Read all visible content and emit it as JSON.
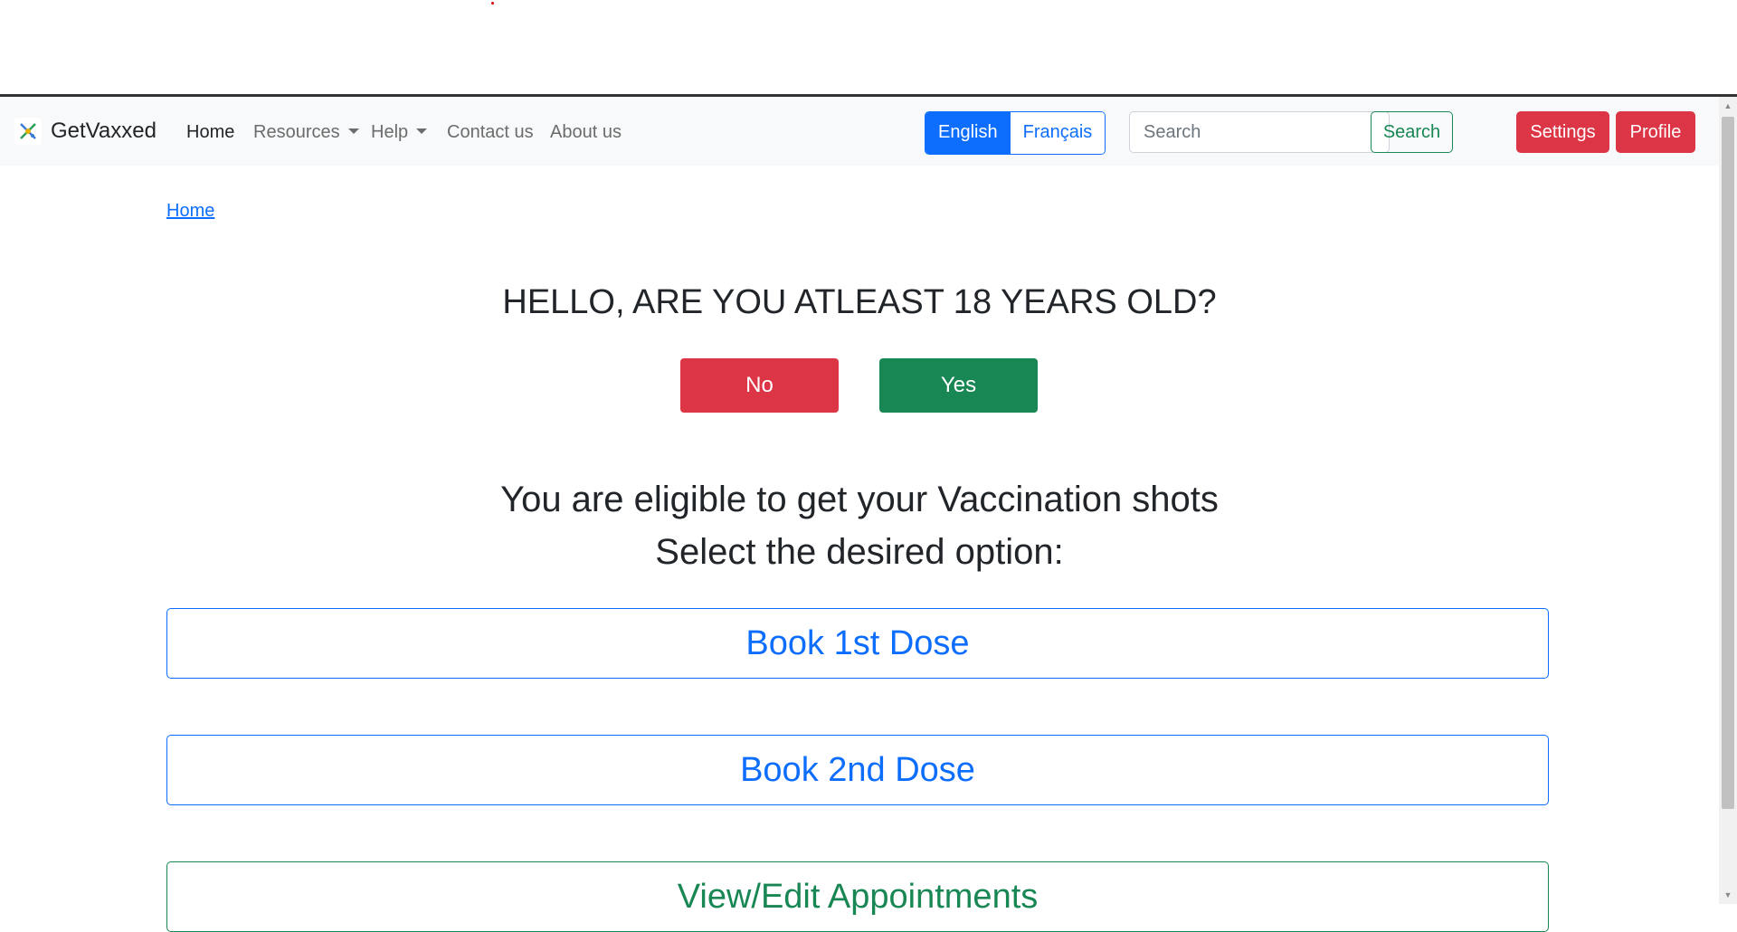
{
  "nav": {
    "brand": "GetVaxxed",
    "home": "Home",
    "resources": "Resources",
    "help": "Help",
    "contact": "Contact us",
    "about": "About us",
    "lang_en": "English",
    "lang_fr": "Français",
    "search_placeholder": "Search",
    "search_button": "Search",
    "settings": "Settings",
    "profile": "Profile"
  },
  "breadcrumb": "Home",
  "question": "HELLO, ARE YOU ATLEAST 18 YEARS OLD?",
  "no_label": "No",
  "yes_label": "Yes",
  "eligible": "You are eligible to get your Vaccination shots",
  "select_option": "Select the desired option:",
  "options": {
    "book1": "Book 1st Dose",
    "book2": "Book 2nd Dose",
    "view_edit": "View/Edit Appointments"
  },
  "colors": {
    "primary": "#0d6efd",
    "success": "#198754",
    "danger": "#dc3545"
  }
}
